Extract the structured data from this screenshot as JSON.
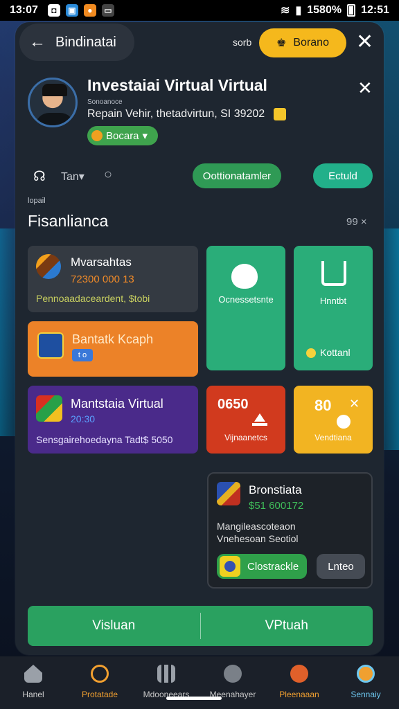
{
  "status_bar": {
    "time": "13:07",
    "right_text": "1580%",
    "clock_right": "12:51"
  },
  "topbar": {
    "back_label": "Bindinatai",
    "sort_label": "sorb",
    "gold_button_label": "Borano"
  },
  "profile": {
    "title": "Investaiai Virtual Virtual",
    "subtitle": "Sonoanoce",
    "description": "Repain Vehir, thetadvirtun, SI 39202",
    "badge_label": "Bocara"
  },
  "filters": {
    "tag_label": "Tan",
    "pill_green": "Oottionatamler",
    "pill_teal": "Ectuld"
  },
  "section": {
    "small_label": "lopail",
    "title": "Fisanlianca",
    "count": "99 ×"
  },
  "cards": {
    "c1": {
      "title": "Mvarsahtas",
      "value": "72300 000 13",
      "desc": "Pennoaadaceardent, $tobi"
    },
    "c2": {
      "label": "Ocnessetsnte"
    },
    "c3": {
      "label": "Hnntbt",
      "footer": "Kottanl"
    },
    "c4": {
      "title": "Bantatk Kcaph",
      "tag": "t o"
    },
    "c5": {
      "title": "Mantstaia Virtual",
      "value": "20:30",
      "desc": "Sensgairehoedayna Tadt$ 5050"
    },
    "c6": {
      "number": "0650",
      "label": "Vijnaanetcs"
    },
    "c7": {
      "number": "80",
      "label": "Vendtiana"
    },
    "c8": {
      "title": "Bronstiata",
      "value": "$51 600172",
      "desc1": "Mangileascoteaon",
      "desc2": "Vnehesoan Seotiol",
      "primary_button": "Clostrackle",
      "secondary_button": "Lnteo"
    }
  },
  "bottom_action": {
    "left": "Visluan",
    "right": "VPtuah"
  },
  "nav": [
    {
      "label": "Hanel",
      "color": "#d0d0d0",
      "icon": "home-icon"
    },
    {
      "label": "Protatade",
      "color": "#f2a030",
      "icon": "coin-icon"
    },
    {
      "label": "Mdooneears",
      "color": "#c8c8c8",
      "icon": "grid-icon"
    },
    {
      "label": "Meenahayer",
      "color": "#c8c8c8",
      "icon": "camera-icon"
    },
    {
      "label": "Pleenaaan",
      "color": "#f2a030",
      "icon": "notification-icon"
    },
    {
      "label": "Sennaiy",
      "color": "#6ec8f0",
      "icon": "globe-icon"
    }
  ]
}
